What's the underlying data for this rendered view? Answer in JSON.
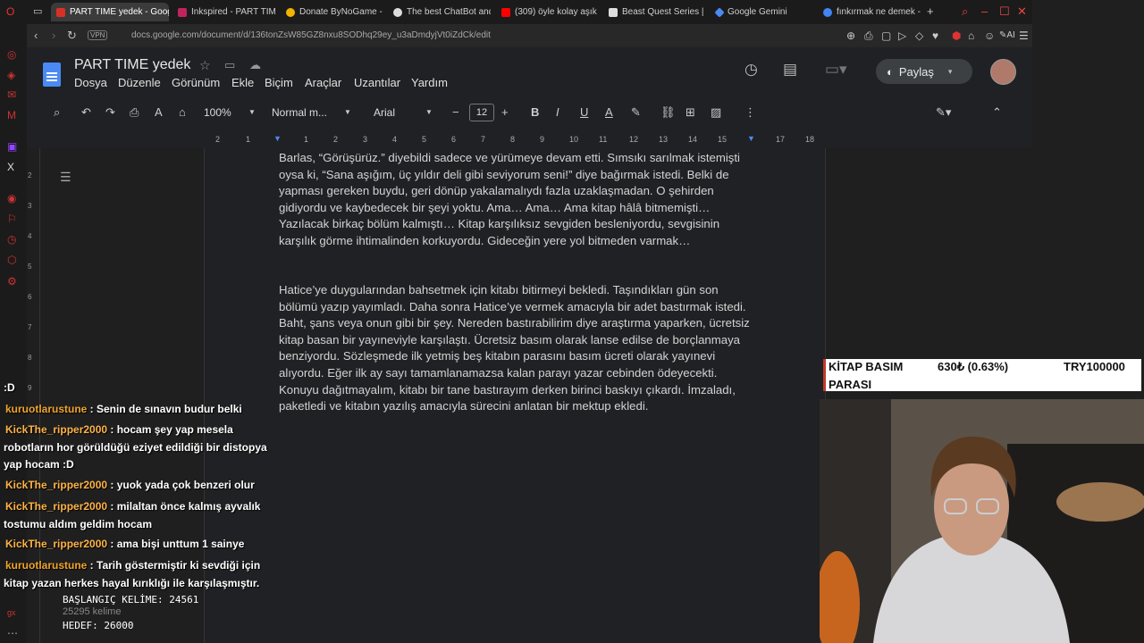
{
  "browser": {
    "tabs": [
      {
        "label": "PART TIME yedek - Googl",
        "active": true,
        "color": "#d93025"
      },
      {
        "label": "Inkspired - PART TIME",
        "active": false,
        "color": "#c0245c"
      },
      {
        "label": "Donate ByNoGame - G",
        "active": false,
        "color": "#f2b300"
      },
      {
        "label": "The best ChatBot and",
        "active": false,
        "color": "#ddd"
      },
      {
        "label": "(309) öyle kolay aşık o",
        "active": false,
        "color": "#ff0000"
      },
      {
        "label": "Beast Quest Series | E",
        "active": false,
        "color": "#ddd"
      },
      {
        "label": "Google Gemini",
        "active": false,
        "color": "#4a8af4"
      },
      {
        "label": "fınkırmak ne demek - G",
        "active": false,
        "color": "#4285f4"
      }
    ],
    "vpn": "VPN",
    "url": "docs.google.com/document/d/136tonZsW85GZ8nxu8SODhq29ey_u3aDmdyjVt0iZdCk/edit"
  },
  "docs": {
    "title": "PART TIME  yedek",
    "menus": [
      "Dosya",
      "Düzenle",
      "Görünüm",
      "Ekle",
      "Biçim",
      "Araçlar",
      "Uzantılar",
      "Yardım"
    ],
    "share_label": "Paylaş",
    "zoom": "100%",
    "style": "Normal m...",
    "font": "Arial",
    "font_size": "12",
    "ruler_numbers": [
      "2",
      "1",
      "1",
      "2",
      "3",
      "4",
      "5",
      "6",
      "7",
      "8",
      "9",
      "10",
      "11",
      "12",
      "13",
      "14",
      "15",
      "16",
      "17",
      "18"
    ],
    "paragraphs": [
      "Barlas, “Görüşürüz.” diyebildi sadece ve yürümeye devam etti. Sımsıkı sarılmak istemişti oysa ki, “Sana aşığım, üç yıldır deli gibi seviyorum seni!” diye bağırmak istedi. Belki de yapması gereken buydu, geri dönüp yakalamalıydı fazla uzaklaşmadan. O şehirden gidiyordu ve kaybedecek bir şeyi yoktu. Ama… Ama… Ama kitap hâlâ bitmemişti… Yazılacak birkaç bölüm kalmıştı… Kitap karşılıksız sevgiden besleniyordu, sevgisinin karşılık görme ihtimalinden korkuyordu. Gideceğin yere yol bitmeden varmak…",
      "Hatice’ye duygularından bahsetmek için kitabı bitirmeyi bekledi. Taşındıkları gün son bölümü yazıp yayımladı. Daha sonra Hatice’ye vermek amacıyla bir adet bastırmak istedi. Baht, şans veya onun gibi bir şey. Nereden bastırabilirim diye araştırma yaparken, ücretsiz kitap basan bir yayıneviyle karşılaştı. Ücretsiz basım olarak lanse edilse de borçlanmaya benziyordu. Sözleşmede ilk yetmiş beş kitabın parasını basım ücreti olarak yayınevi alıyordu. Eğer ilk ay sayı tamamlanamazsa kalan parayı yazar cebinden ödeyecekti. Konuyu dağıtmayalım, kitabı bir tane bastırayım derken birinci baskıyı çıkardı. İmzaladı, paketledi ve kitabın yazılış amacıyla sürecini anlatan bir mektup ekledi."
    ],
    "word_count": "25295 kelime"
  },
  "overlay": {
    "label": "KİTAP BASIM PARASI",
    "label_line1": "KİTAP BASIM",
    "label_line2": "PARASI",
    "amount": "630₺ (0.63%)",
    "goal": "TRY100000"
  },
  "counter": {
    "start": "BAŞLANGIÇ KELİME: 24561",
    "target": "HEDEF: 26000"
  },
  "chat": [
    {
      "user": "",
      "text": ":D"
    },
    {
      "user": "kuruotlarustune",
      "text": " : Senin de sınavın budur belki"
    },
    {
      "user": "KickThe_ripper2000",
      "text": " : hocam şey yap mesela robotların hor görüldüğü eziyet edildiği bir distopya yap hocam :D"
    },
    {
      "user": "KickThe_ripper2000",
      "text": " : yuok yada çok benzeri olur"
    },
    {
      "user": "KickThe_ripper2000",
      "text": " : milaltan önce kalmış ayvalık tostumu aldım geldim hocam"
    },
    {
      "user": "KickThe_ripper2000",
      "text": " : ama bişi unttum 1 sainye"
    },
    {
      "user": "kuruotlarustune",
      "text": " : Tarih göstermiştir ki sevdiği için kitap yazan herkes hayal kırıklığı ile karşılaşmıştır."
    }
  ]
}
